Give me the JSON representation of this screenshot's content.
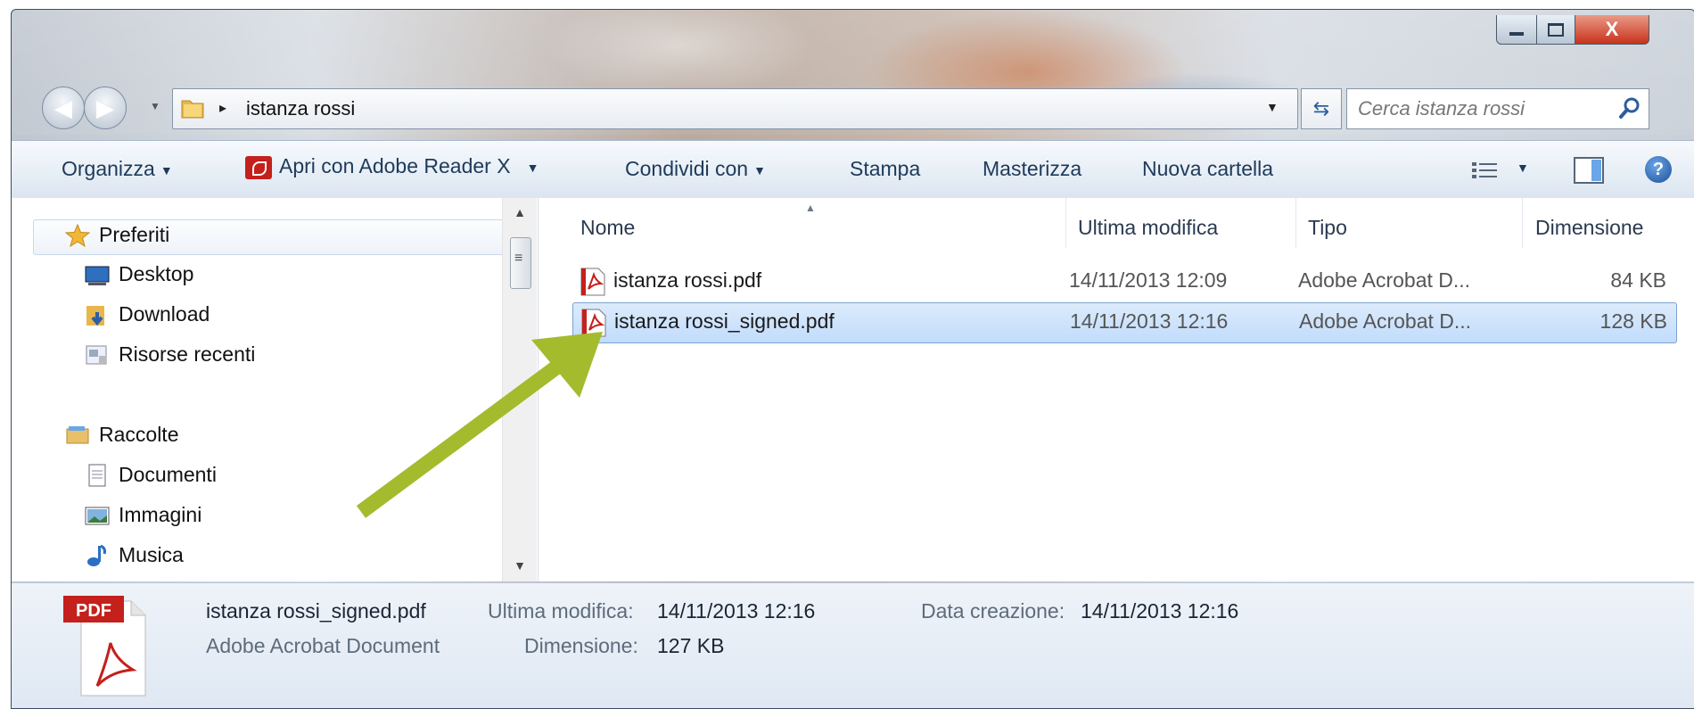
{
  "window": {
    "controls": {
      "minimize_icon": "minimize-icon",
      "maximize_icon": "maximize-icon",
      "close_label": "X"
    }
  },
  "nav": {
    "address": {
      "path_segment": "istanza rossi",
      "separator": "▸"
    },
    "search": {
      "placeholder": "Cerca istanza rossi"
    }
  },
  "toolbar": {
    "organize": "Organizza",
    "open_with": "Apri con Adobe Reader X",
    "share": "Condividi con",
    "print": "Stampa",
    "burn": "Masterizza",
    "new_folder": "Nuova cartella"
  },
  "sidebar": {
    "favorites": {
      "title": "Preferiti",
      "items": [
        {
          "label": "Desktop",
          "icon": "desktop-icon"
        },
        {
          "label": "Download",
          "icon": "downloads-folder-icon"
        },
        {
          "label": "Risorse recenti",
          "icon": "recent-places-icon"
        }
      ]
    },
    "libraries": {
      "title": "Raccolte",
      "items": [
        {
          "label": "Documenti",
          "icon": "documents-icon"
        },
        {
          "label": "Immagini",
          "icon": "pictures-icon"
        },
        {
          "label": "Musica",
          "icon": "music-icon"
        }
      ]
    }
  },
  "filelist": {
    "columns": [
      "Nome",
      "Ultima modifica",
      "Tipo",
      "Dimensione"
    ],
    "rows": [
      {
        "name": "istanza rossi.pdf",
        "modified": "14/11/2013 12:09",
        "type": "Adobe Acrobat D...",
        "size": "84 KB",
        "selected": false
      },
      {
        "name": "istanza rossi_signed.pdf",
        "modified": "14/11/2013 12:16",
        "type": "Adobe Acrobat D...",
        "size": "128 KB",
        "selected": true
      }
    ]
  },
  "details": {
    "file_name": "istanza rossi_signed.pdf",
    "file_type": "Adobe Acrobat Document",
    "modified_label": "Ultima modifica:",
    "modified_value": "14/11/2013 12:16",
    "created_label": "Data creazione:",
    "created_value": "14/11/2013 12:16",
    "size_label": "Dimensione:",
    "size_value": "127 KB",
    "thumb_badge": "PDF"
  },
  "colors": {
    "arrow": "#a3bb2d",
    "selection": "#c1dcfc",
    "pdf_red": "#c4201c"
  }
}
